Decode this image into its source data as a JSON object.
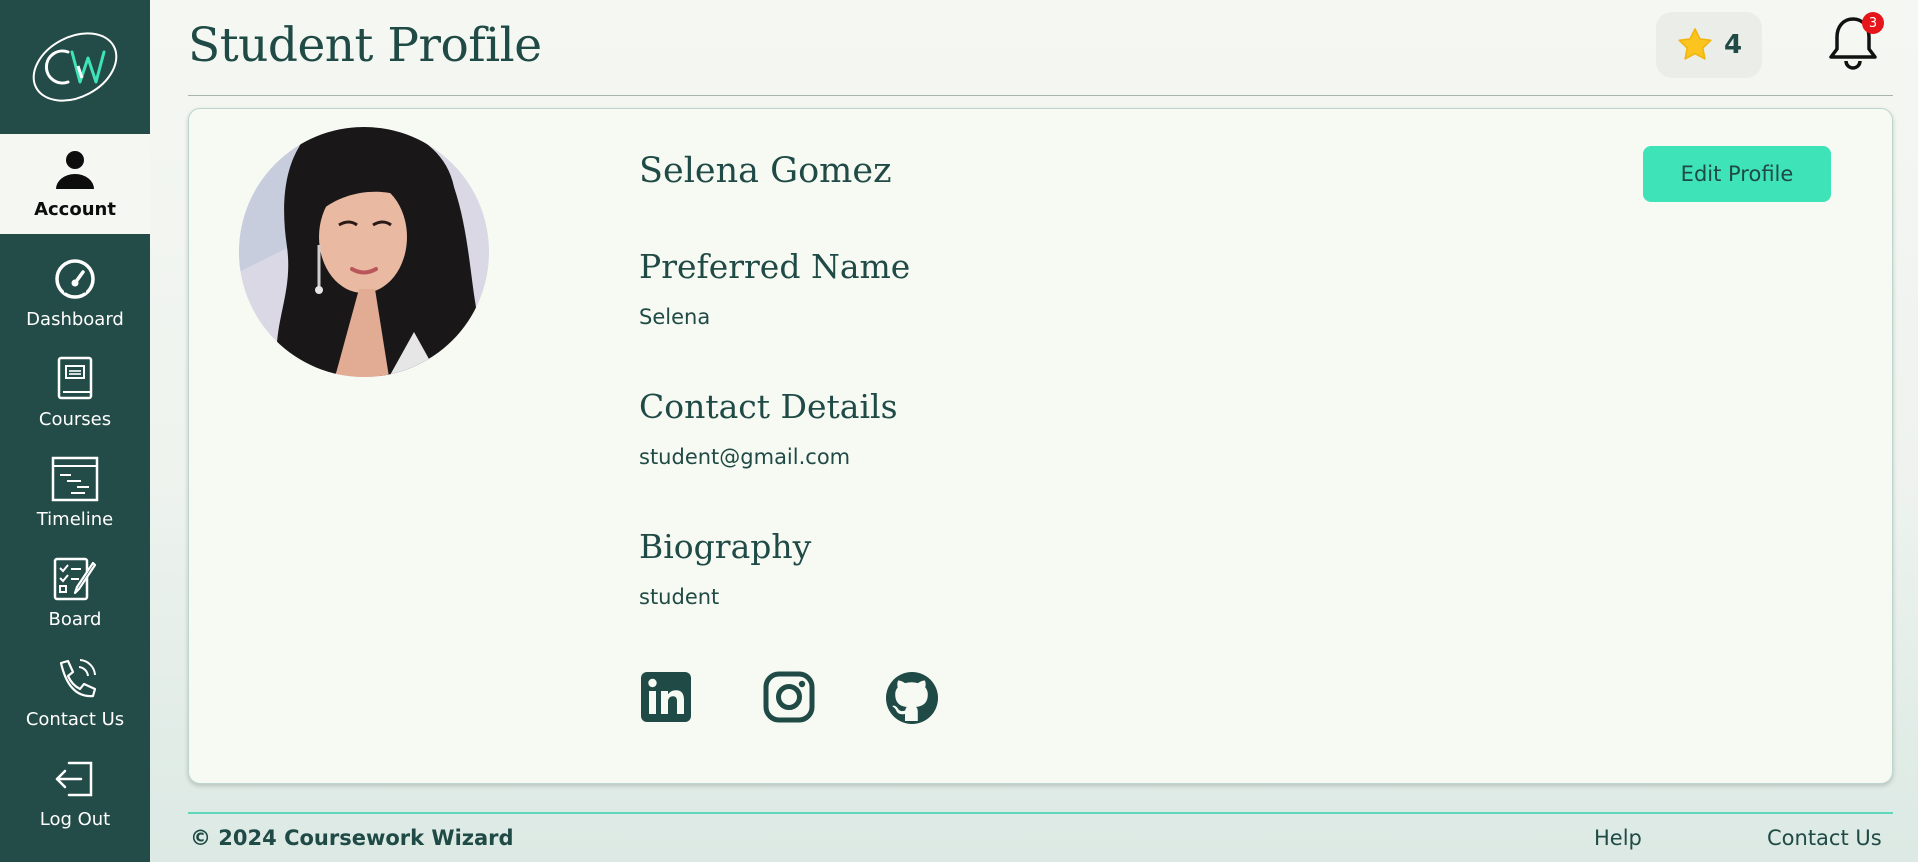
{
  "app": {
    "logo_text": "CW",
    "page_title": "Student Profile"
  },
  "sidebar": {
    "items": [
      {
        "label": "Account",
        "icon": "person-icon",
        "active": true
      },
      {
        "label": "Dashboard",
        "icon": "speedometer-icon"
      },
      {
        "label": "Courses",
        "icon": "book-icon"
      },
      {
        "label": "Timeline",
        "icon": "timeline-icon"
      },
      {
        "label": "Board",
        "icon": "checklist-icon"
      },
      {
        "label": "Contact Us",
        "icon": "phone-icon"
      },
      {
        "label": "Log Out",
        "icon": "logout-icon"
      }
    ]
  },
  "header": {
    "points": "4",
    "points_icon": "star-icon",
    "notification_count": "3",
    "notification_icon": "bell-icon"
  },
  "profile": {
    "name": "Selena Gomez",
    "edit_label": "Edit Profile",
    "sections": [
      {
        "heading": "Preferred Name",
        "value": "Selena"
      },
      {
        "heading": "Contact Details",
        "value": "student@gmail.com"
      },
      {
        "heading": "Biography",
        "value": "student"
      }
    ],
    "socials": [
      "linkedin-icon",
      "instagram-icon",
      "github-icon"
    ]
  },
  "footer": {
    "copyright": "© 2024 Coursework Wizard",
    "links": [
      "Help",
      "Contact Us"
    ]
  },
  "colors": {
    "sidebar": "#234b47",
    "accent": "#3ee3b8",
    "text": "#1f4a45",
    "badge": "#e5151b"
  }
}
